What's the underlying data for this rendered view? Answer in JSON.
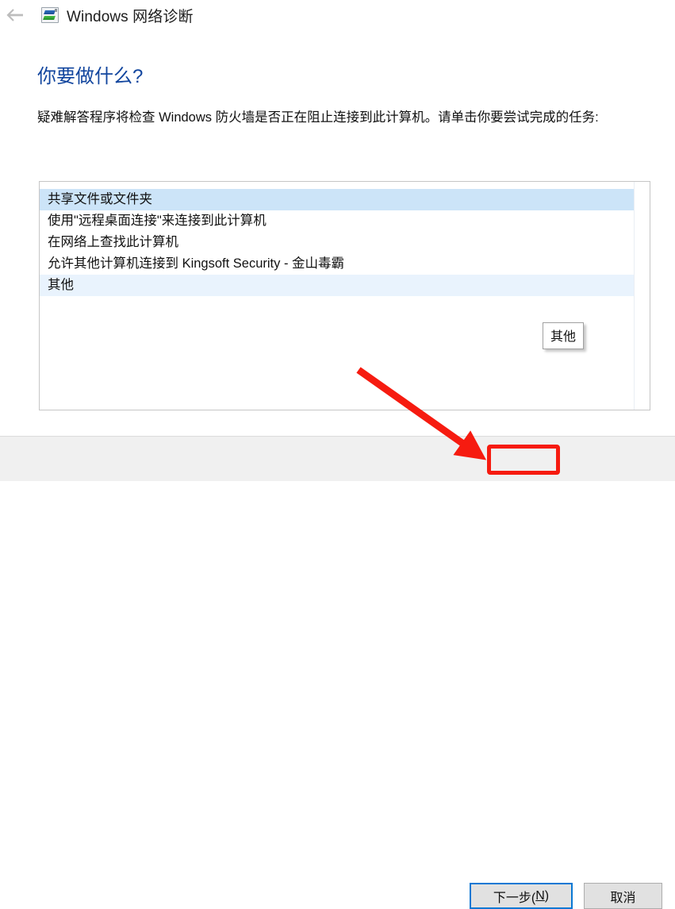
{
  "window": {
    "title": "Windows 网络诊断",
    "back_icon": "back-arrow-icon",
    "app_icon": "network-diagnostic-icon"
  },
  "page": {
    "heading": "你要做什么?",
    "description": "疑难解答程序将检查 Windows 防火墙是否正在阻止连接到此计算机。请单击你要尝试完成的任务:"
  },
  "list": {
    "items": [
      {
        "label": "共享文件或文件夹",
        "state": "selected"
      },
      {
        "label": "使用\"远程桌面连接\"来连接到此计算机",
        "state": "normal"
      },
      {
        "label": "在网络上查找此计算机",
        "state": "normal"
      },
      {
        "label": "允许其他计算机连接到 Kingsoft Security - 金山毒霸",
        "state": "normal"
      },
      {
        "label": "其他",
        "state": "hovered"
      }
    ]
  },
  "tooltip": {
    "text": "其他"
  },
  "footer": {
    "next_label": "下一步(",
    "next_accel": "N",
    "next_label_end": ")",
    "cancel_label": "取消"
  },
  "annotations": {
    "arrow_color": "#f61b10",
    "highlight_color": "#f61b10",
    "focus_color": "#0a78d4"
  },
  "colors": {
    "heading": "#11459e",
    "selected_row": "#cce4f8",
    "hovered_row": "#e9f3fd",
    "footer_bg": "#f0f0f0"
  }
}
